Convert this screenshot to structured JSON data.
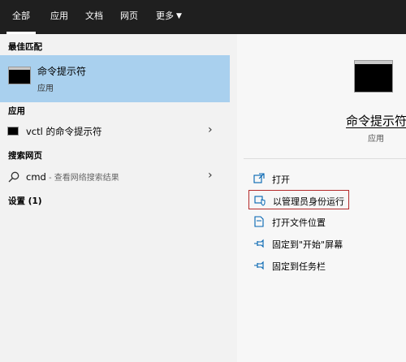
{
  "tabs": [
    {
      "label": "全部",
      "active": true
    },
    {
      "label": "应用"
    },
    {
      "label": "文档"
    },
    {
      "label": "网页"
    },
    {
      "label": "更多"
    }
  ],
  "sections": {
    "best_match": "最佳匹配",
    "apps": "应用",
    "web": "搜索网页",
    "settings": "设置 (1)"
  },
  "best_match_item": {
    "name": "命令提示符",
    "type": "应用"
  },
  "app_item": {
    "label": "vctl 的命令提示符"
  },
  "web_item": {
    "query": "cmd",
    "hint": " - 查看网络搜索结果"
  },
  "detail": {
    "title": "命令提示符",
    "subtitle": "应用",
    "actions": [
      {
        "label": "打开",
        "icon": "open-icon"
      },
      {
        "label": "以管理员身份运行",
        "icon": "admin-shield-icon",
        "highlighted": true
      },
      {
        "label": "打开文件位置",
        "icon": "file-location-icon"
      },
      {
        "label": "固定到\"开始\"屏幕",
        "icon": "pin-icon"
      },
      {
        "label": "固定到任务栏",
        "icon": "pin-icon"
      }
    ]
  },
  "colors": {
    "topbar": "#1f1f1f",
    "selection": "#a9d0ee",
    "accent": "#0063b1",
    "highlight_border": "#b42a2a"
  }
}
